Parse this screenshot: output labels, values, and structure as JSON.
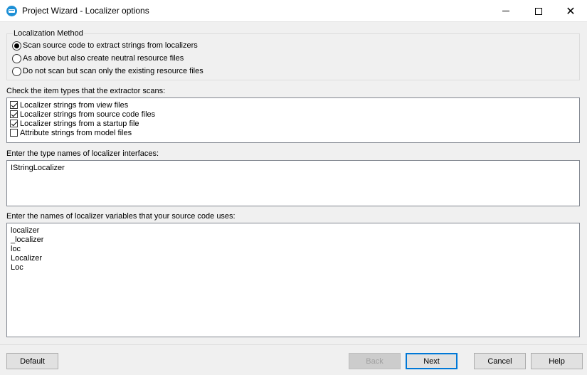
{
  "window": {
    "title": "Project Wizard - Localizer options",
    "icon": "app-icon"
  },
  "localization_method": {
    "legend": "Localization Method",
    "options": [
      {
        "label": "Scan source code to extract strings from localizers",
        "selected": true
      },
      {
        "label": "As above but also create neutral resource files",
        "selected": false
      },
      {
        "label": "Do not scan but scan only the existing resource files",
        "selected": false
      }
    ]
  },
  "item_types": {
    "label": "Check the item types that the extractor scans:",
    "items": [
      {
        "label": "Localizer strings from view files",
        "checked": true
      },
      {
        "label": "Localizer strings from source code files",
        "checked": true
      },
      {
        "label": "Localizer strings from a startup file",
        "checked": true
      },
      {
        "label": "Attribute strings from model files",
        "checked": false
      }
    ]
  },
  "interfaces": {
    "label": "Enter the type names of localizer interfaces:",
    "lines": [
      "IStringLocalizer"
    ]
  },
  "variables": {
    "label": "Enter the names of localizer variables that your source code uses:",
    "lines": [
      "localizer",
      "_localizer",
      "loc",
      "Localizer",
      "Loc"
    ]
  },
  "buttons": {
    "default": "Default",
    "back": "Back",
    "next": "Next",
    "cancel": "Cancel",
    "help": "Help"
  },
  "colors": {
    "accent": "#0078d7",
    "app_icon": "#1e90d6"
  }
}
